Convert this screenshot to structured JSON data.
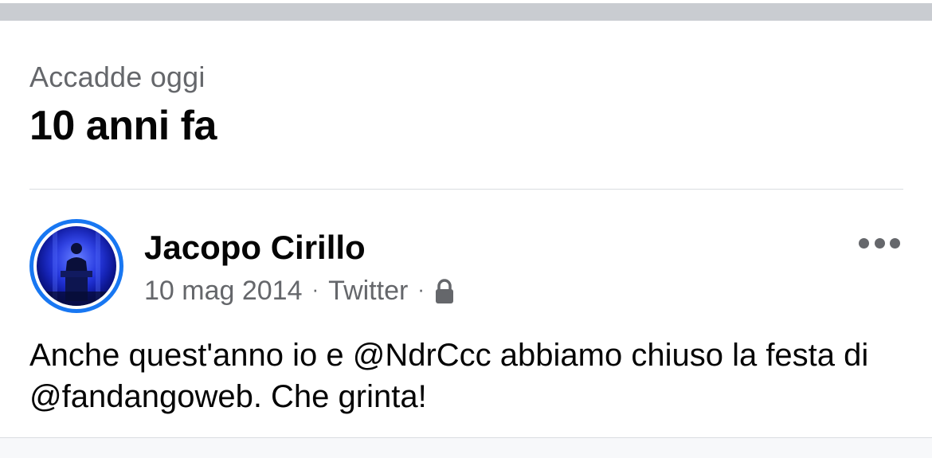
{
  "memory": {
    "subtitle": "Accadde oggi",
    "title": "10 anni fa"
  },
  "post": {
    "author": "Jacopo Cirillo",
    "date": "10 mag 2014",
    "separator": "·",
    "source": "Twitter",
    "privacy_icon": "lock-icon",
    "more_icon": "more-options-icon",
    "text": "Anche quest'anno io e @NdrCcc abbiamo chiuso la festa di @fandangoweb. Che grinta!"
  },
  "colors": {
    "accent": "#1877f2",
    "primary_text": "#050505",
    "secondary_text": "#65676b",
    "divider": "#dadde1",
    "top_bar": "#c9ccd1"
  }
}
